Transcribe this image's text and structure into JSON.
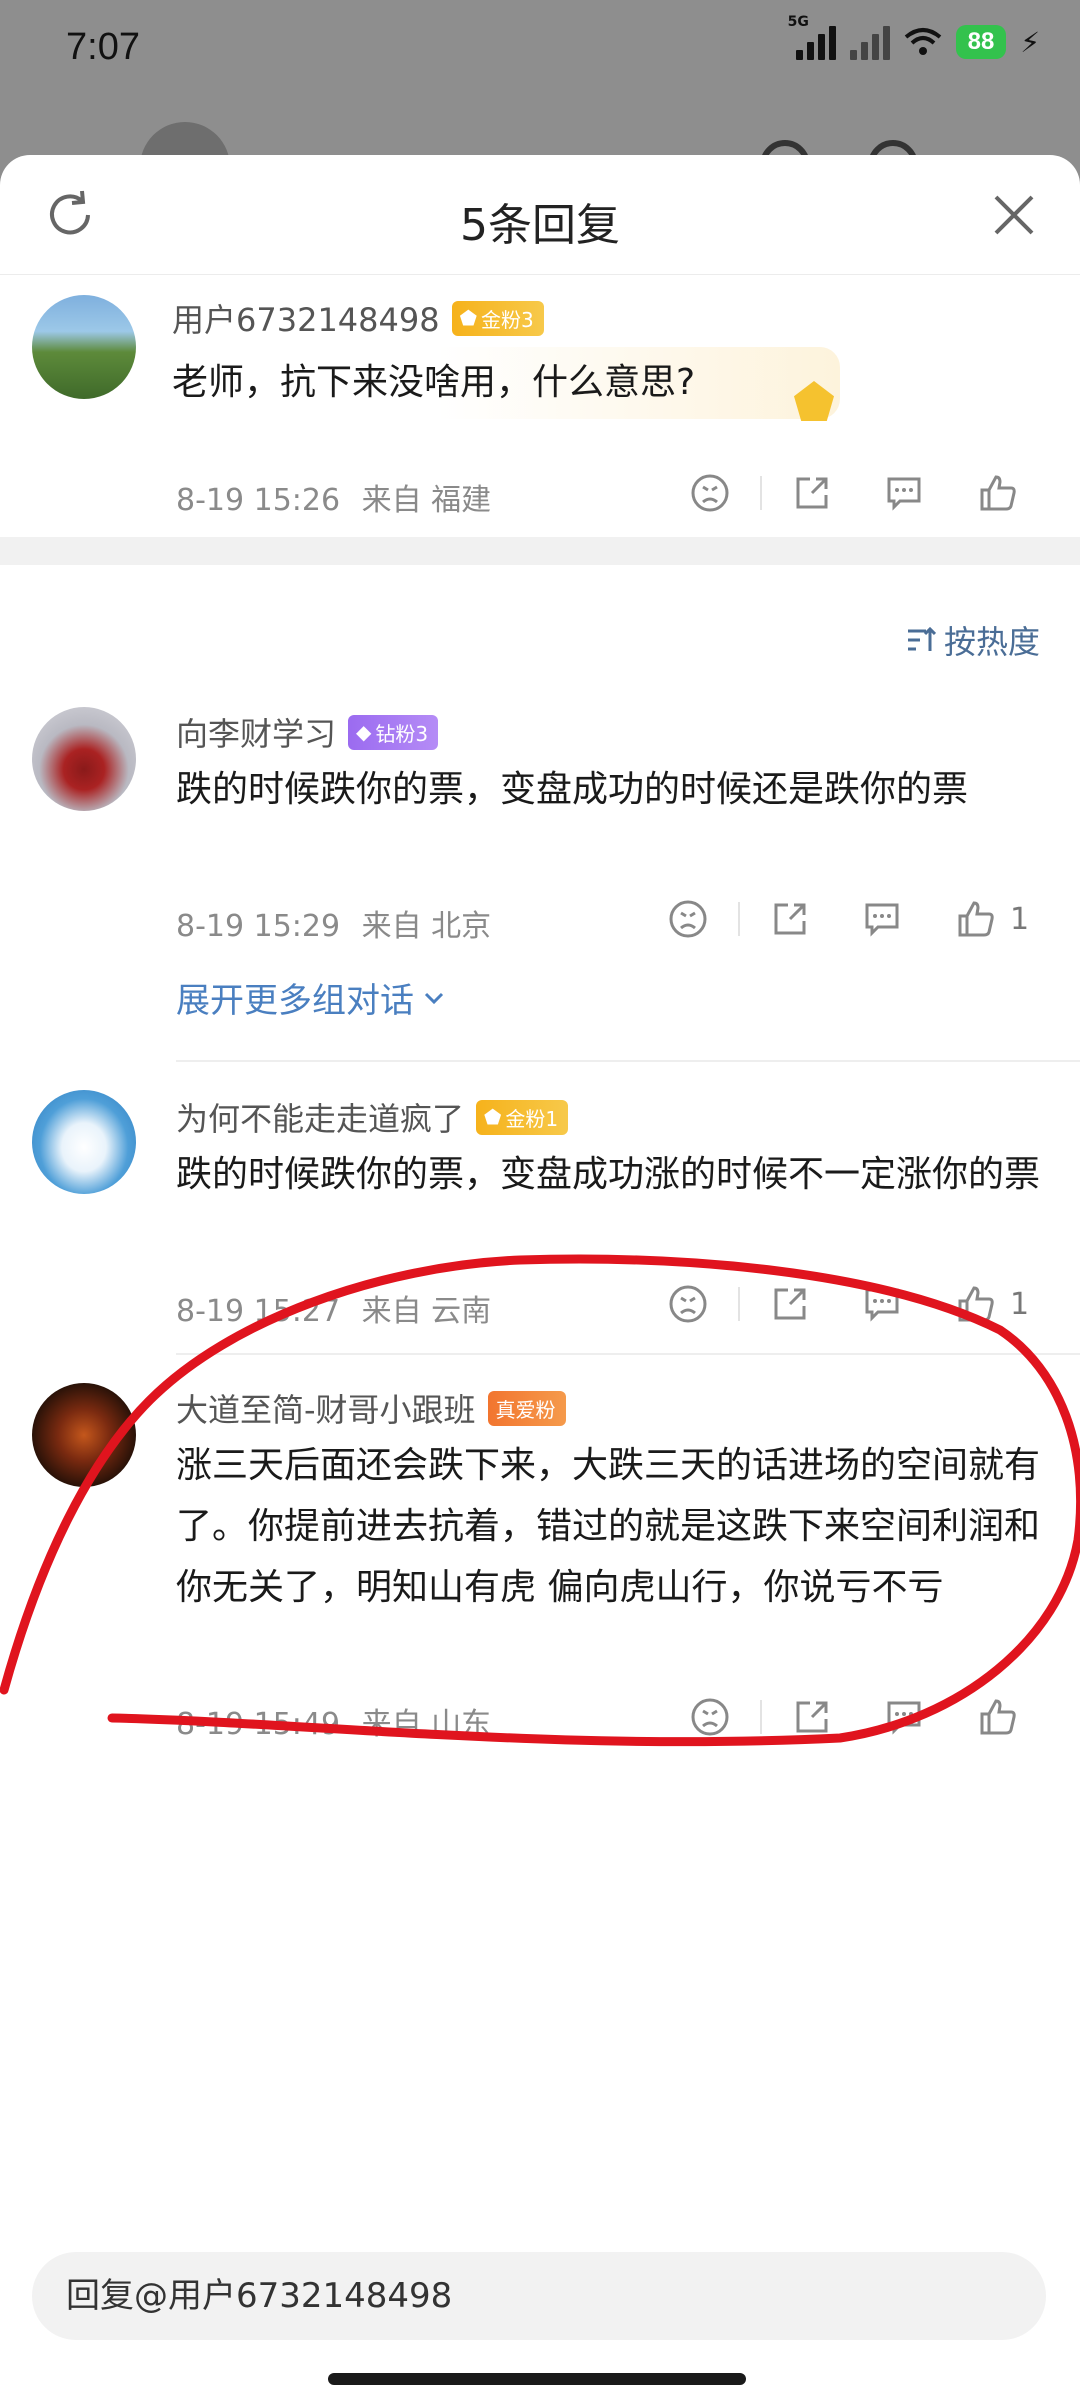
{
  "status_bar": {
    "time": "7:07",
    "network": "5G",
    "battery": "88"
  },
  "sheet": {
    "title": "5条回复"
  },
  "original_comment": {
    "username": "用户6732148498",
    "badge": "金粉3",
    "text": "老师，抗下来没啥用，什么意思?",
    "date": "8-19 15:26",
    "location": "来自 福建"
  },
  "sort_label": "按热度",
  "replies": [
    {
      "username": "向李财学习",
      "badge": "钻粉3",
      "text": "跌的时候跌你的票，变盘成功的时候还是跌你的票",
      "date": "8-19 15:29",
      "location": "来自 北京",
      "likes": "1",
      "expand_label": "展开更多组对话"
    },
    {
      "username": "为何不能走走道疯了",
      "badge": "金粉1",
      "text": "跌的时候跌你的票，变盘成功涨的时候不一定涨你的票",
      "date": "8-19 15:27",
      "location": "来自 云南",
      "likes": "1"
    },
    {
      "username": "大道至简-财哥小跟班",
      "badge": "真爱粉",
      "text": "涨三天后面还会跌下来，大跌三天的话进场的空间就有了。你提前进去抗着，错过的就是这跌下来空间利润和你无关了，明知山有虎 偏向虎山行，你说亏不亏",
      "date": "8-19 15:49",
      "location": "来自 山东"
    }
  ],
  "reply_input": {
    "placeholder": "回复@用户6732148498"
  },
  "colors": {
    "link": "#4a7fc0",
    "sort": "#4a6d96",
    "gold_badge": "#f6b21b",
    "diamond_badge": "#9b6bf0",
    "love_badge": "#f2752f",
    "annotation_red": "#e0141e"
  }
}
